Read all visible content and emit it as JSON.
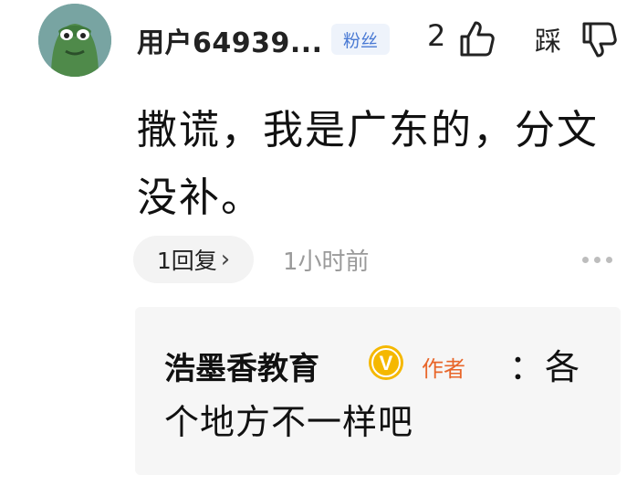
{
  "comment": {
    "username": "用户64939...",
    "badge": "粉丝",
    "like_count": "2",
    "dislike_label": "踩",
    "text": "撒谎，我是广东的，分文没补。",
    "reply_count_label": "1回复",
    "reply_chevron": "›",
    "time": "1小时前"
  },
  "reply": {
    "author": "浩墨香教育",
    "verified_mark": "V",
    "author_tag": "作者",
    "separator": "：",
    "text": "各个地方不一样吧"
  },
  "colors": {
    "badge_blue": "#4a7ad4",
    "verified_yellow": "#f5b800",
    "author_tag_orange": "#e8662a",
    "avatar_bg": "#78a4a2"
  }
}
